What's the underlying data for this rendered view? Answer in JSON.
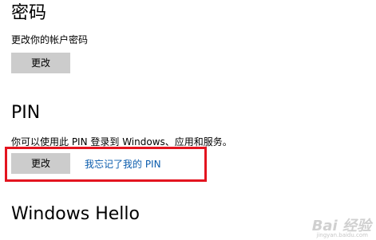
{
  "password": {
    "title": "密码",
    "description": "更改你的帐户密码",
    "change_button": "更改"
  },
  "pin": {
    "title": "PIN",
    "description": "你可以使用此 PIN 登录到 Windows、应用和服务。",
    "change_button": "更改",
    "forgot_link": "我忘记了我的 PIN"
  },
  "windows_hello": {
    "title": "Windows Hello"
  },
  "watermark": {
    "text": "Bai 经验",
    "sub": "jingyan.baidu.com"
  },
  "colors": {
    "button_bg": "#cccccc",
    "link": "#0b5cad",
    "highlight": "#e3141f"
  }
}
